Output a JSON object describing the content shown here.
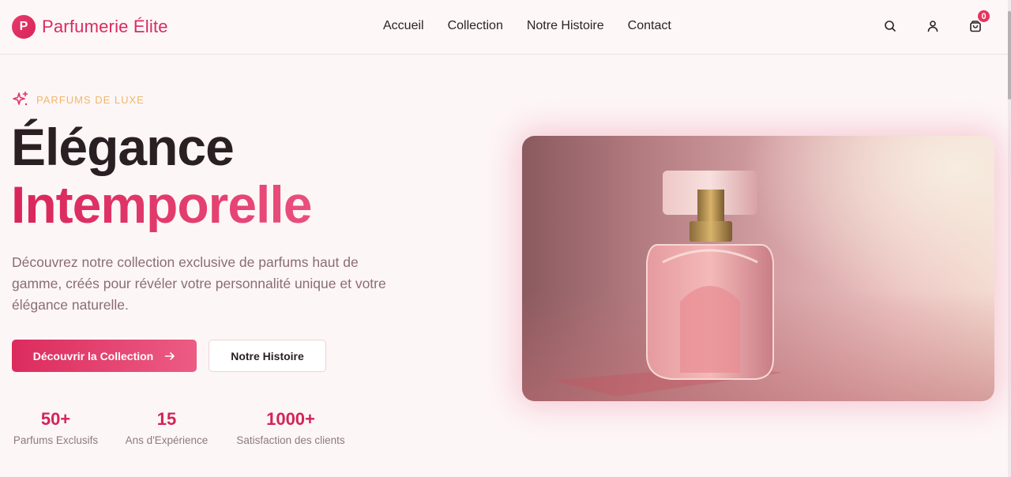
{
  "brand": {
    "logo_letter": "P",
    "name": "Parfumerie Élite",
    "accent": "#d92b5f"
  },
  "nav": [
    {
      "label": "Accueil"
    },
    {
      "label": "Collection"
    },
    {
      "label": "Notre Histoire"
    },
    {
      "label": "Contact"
    }
  ],
  "header_icons": {
    "search": "search-icon",
    "account": "user-icon",
    "cart": "shopping-bag-icon",
    "cart_count": "0"
  },
  "hero": {
    "eyebrow_icon": "sparkles-icon",
    "eyebrow": "PARFUMS DE LUXE",
    "title_line1": "Élégance",
    "title_line2": "Intemporelle",
    "description": "Découvrez notre collection exclusive de parfums haut de gamme, créés pour révéler votre personnalité unique et votre élégance naturelle.",
    "primary_cta": "Découvrir la Collection",
    "primary_cta_icon": "arrow-right-icon",
    "secondary_cta": "Notre Histoire",
    "image_subject": "perfume-bottle-image"
  },
  "stats": [
    {
      "value": "50+",
      "label": "Parfums Exclusifs"
    },
    {
      "value": "15",
      "label": "Ans d'Expérience"
    },
    {
      "value": "1000+",
      "label": "Satisfaction des clients"
    }
  ]
}
